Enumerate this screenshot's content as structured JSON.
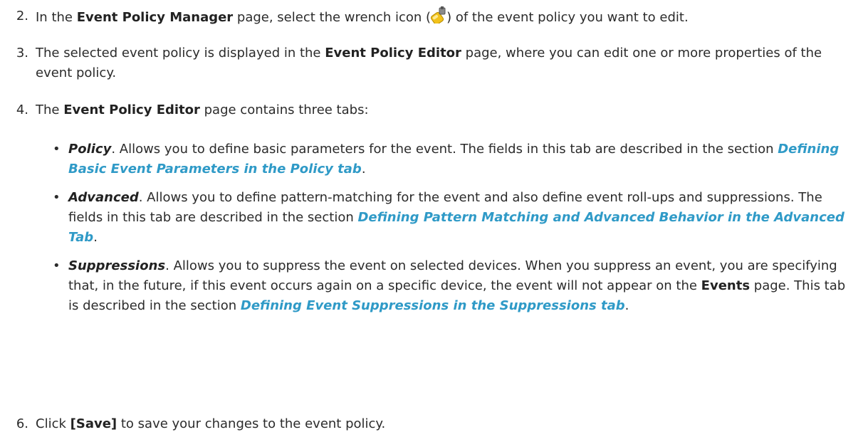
{
  "steps": [
    {
      "number": "2.",
      "before": "In the ",
      "bold": "Event Policy Manager",
      "middle": " page, select the wrench icon (",
      "icon": "wrench-icon",
      "after": ") of the event policy you want to edit."
    },
    {
      "number": "3.",
      "before": "The selected event policy is displayed in the ",
      "bold": "Event Policy Editor",
      "after": " page, where you can edit one or more properties of the event policy."
    },
    {
      "number": "4.",
      "before": "The ",
      "bold": "Event Policy Editor",
      "after": " page contains three tabs:"
    },
    {
      "number": "6.",
      "before": "Click ",
      "bold": "[Save]",
      "after": " to save your changes to the event policy."
    }
  ],
  "tabs": [
    {
      "term": "Policy",
      "text": ". Allows you to define basic parameters for the event. The fields in this tab are described in the section ",
      "link": "Defining Basic Event Parameters in the Policy tab",
      "end": "."
    },
    {
      "term": "Advanced",
      "text": ". Allows you to define pattern-matching for the event and also define event roll-ups and suppressions. The fields in this tab are described in the section ",
      "link": "Defining Pattern Matching and Advanced Behavior in the Advanced Tab",
      "end": "."
    },
    {
      "term": "Suppressions",
      "text": ". Allows you to suppress the event on selected devices. When you suppress an event, you are specifying that, in the future, if this event occurs again on a specific device, the event will not appear on the ",
      "bold": "Events",
      "text2": " page. This tab is described in the section ",
      "link": "Defining Event Suppressions in the Suppressions tab",
      "end": "."
    }
  ],
  "colors": {
    "link": "#2f9ac7",
    "text": "#2b2b2b",
    "wrench_yellow": "#f2c21b"
  }
}
